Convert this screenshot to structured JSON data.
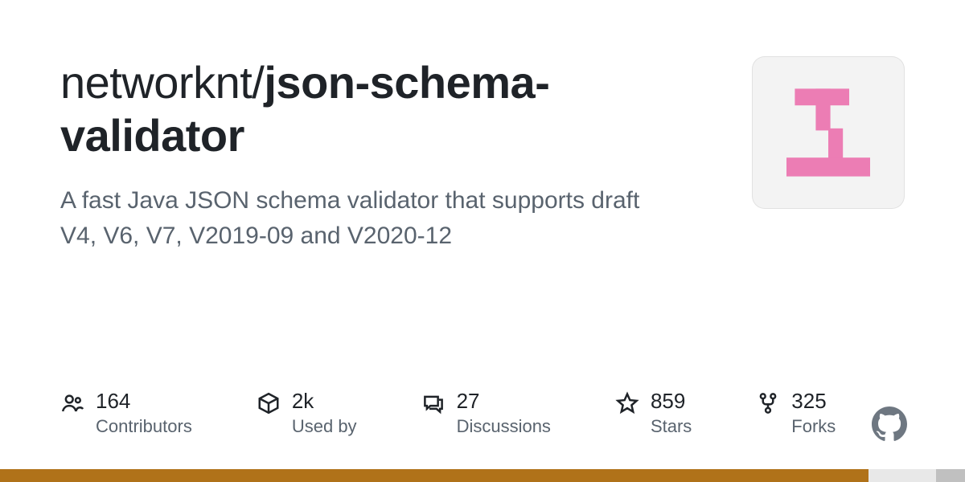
{
  "repo": {
    "owner": "networknt",
    "name": "json-schema-validator"
  },
  "description": "A fast Java JSON schema validator that supports draft V4, V6, V7, V2019-09 and V2020-12",
  "avatar": {
    "bg": "#f3f3f3",
    "shape_color": "#ec7db4"
  },
  "stats": [
    {
      "icon": "people-icon",
      "value": "164",
      "label": "Contributors"
    },
    {
      "icon": "package-icon",
      "value": "2k",
      "label": "Used by"
    },
    {
      "icon": "comment-icon",
      "value": "27",
      "label": "Discussions"
    },
    {
      "icon": "star-icon",
      "value": "859",
      "label": "Stars"
    },
    {
      "icon": "fork-icon",
      "value": "325",
      "label": "Forks"
    }
  ],
  "language_bar": {
    "primary": "#b07219",
    "primary_pct": 90
  }
}
